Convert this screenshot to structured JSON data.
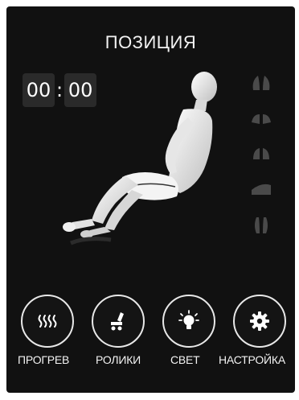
{
  "header": {
    "title": "ПОЗИЦИЯ"
  },
  "timer": {
    "minutes": "00",
    "separator": ":",
    "seconds": "00"
  },
  "side_modes": [
    {
      "icon": "hands-shoulder-icon"
    },
    {
      "icon": "hands-back-icon"
    },
    {
      "icon": "hands-waist-icon"
    },
    {
      "icon": "seat-icon"
    },
    {
      "icon": "feet-icon"
    }
  ],
  "controls": [
    {
      "icon": "heat-waves-icon",
      "label": "ПРОГРЕВ"
    },
    {
      "icon": "rollers-icon",
      "label": "РОЛИКИ"
    },
    {
      "icon": "light-bulb-icon",
      "label": "СВЕТ"
    },
    {
      "icon": "gear-icon",
      "label": "НАСТРОЙКА"
    }
  ],
  "colors": {
    "background": "#111111",
    "text": "#f2f2f2",
    "inactive_icon": "#4a4a4a",
    "timer_box": "#2a2a2a"
  }
}
